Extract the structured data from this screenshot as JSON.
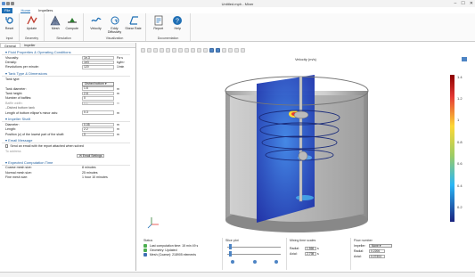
{
  "window": {
    "title": "Untitled.mph - Mixer",
    "controls": [
      "–",
      "☐",
      "✕"
    ]
  },
  "menu": {
    "file": "File",
    "tabs": [
      "Home",
      "Impellers"
    ]
  },
  "ribbon": {
    "groups": [
      {
        "label": "Input",
        "buttons": [
          {
            "label": "Reset",
            "icon": "reset-icon"
          }
        ]
      },
      {
        "label": "Geometry",
        "buttons": [
          {
            "label": "Update",
            "icon": "geometry-update-icon"
          }
        ]
      },
      {
        "label": "Simulation",
        "buttons": [
          {
            "label": "Mesh",
            "icon": "mesh-icon"
          },
          {
            "label": "Compute",
            "icon": "compute-icon"
          }
        ]
      },
      {
        "label": "Visualization",
        "buttons": [
          {
            "label": "Velocity",
            "icon": "velocity-icon"
          },
          {
            "label": "Eddy Diffusivity",
            "icon": "eddy-diffusivity-icon"
          },
          {
            "label": "Shear Rate",
            "icon": "shear-rate-icon"
          }
        ]
      },
      {
        "label": "Documentation",
        "buttons": [
          {
            "label": "Report",
            "icon": "report-icon"
          },
          {
            "label": "Help",
            "icon": "help-icon"
          }
        ]
      }
    ]
  },
  "left_panel": {
    "tabs": [
      "General",
      "Impeller"
    ],
    "fluid": {
      "title": "Fluid Properties & Operating Conditions",
      "rows": [
        {
          "label": "Viscosity:",
          "value": "1e-3",
          "unit": "Pa·s"
        },
        {
          "label": "Density:",
          "value": "1e3",
          "unit": "kg/m³"
        },
        {
          "label": "Revolutions per minute:",
          "value": "120",
          "unit": "1/min"
        }
      ]
    },
    "tank": {
      "title": "Tank Type & Dimensions",
      "type_label": "Tank type:",
      "type_value": "Dished bottom",
      "rows": [
        {
          "label": "Tank diameter:",
          "value": "1.6",
          "unit": "m",
          "disabled": false
        },
        {
          "label": "Tank height:",
          "value": "2.6",
          "unit": "m",
          "disabled": false
        },
        {
          "label": "Number of baffles:",
          "value": "0",
          "unit": "",
          "disabled": false
        },
        {
          "label": "Baffle width:",
          "value": "0.1",
          "unit": "m",
          "disabled": true
        }
      ],
      "dished_label": "Dished bottom tank",
      "ellipse_label": "Length of bottom ellipse's minor axis:",
      "ellipse_value": "0.3",
      "ellipse_unit": "m"
    },
    "shaft": {
      "title": "Impeller Shaft",
      "rows": [
        {
          "label": "Diameter:",
          "value": "0.05",
          "unit": "m"
        },
        {
          "label": "Length:",
          "value": "2.2",
          "unit": "m"
        },
        {
          "label": "Position (z) of the lowest part of the shaft:",
          "value": "0",
          "unit": "m"
        }
      ]
    },
    "email": {
      "title": "Email Message",
      "send_label": "Send an email with the report attached when solved",
      "address_placeholder": "To address",
      "settings_label": "Email Settings"
    },
    "time": {
      "title": "Expected Computation Time",
      "rows": [
        {
          "label": "Coarse mesh size:",
          "value": "8 minutes"
        },
        {
          "label": "Normal mesh size:",
          "value": "25 minutes"
        },
        {
          "label": "Fine mesh size:",
          "value": "1 hour 10 minutes"
        }
      ]
    }
  },
  "graphics": {
    "title": "Velocity (m/s)",
    "colorbar_ticks": [
      "1.4",
      "1.2",
      "1",
      "0.8",
      "0.6",
      "0.4",
      "0.2"
    ]
  },
  "status": {
    "title": "Status",
    "items": [
      {
        "text": "Last computation time: 15 min 49 s",
        "color": "#4caf50"
      },
      {
        "text": "Geometry: Updated",
        "color": "#4caf50"
      },
      {
        "text": "Mesh (Coarse): 218905 elements",
        "color": "#3f6fb5"
      }
    ]
  },
  "slice": {
    "title": "Slice plot"
  },
  "mixing": {
    "title": "Mixing time scales",
    "rows": [
      {
        "label": "Radial:",
        "value": "1.566",
        "unit": "s"
      },
      {
        "label": "Axial:",
        "value": "2.798",
        "unit": "s"
      }
    ]
  },
  "flow": {
    "title": "Flow number",
    "impeller_label": "Impeller:",
    "impeller_value": "None",
    "rows": [
      {
        "label": "Radial:",
        "value": "0.2206"
      },
      {
        "label": "Axial:",
        "value": "0.07404"
      }
    ]
  }
}
